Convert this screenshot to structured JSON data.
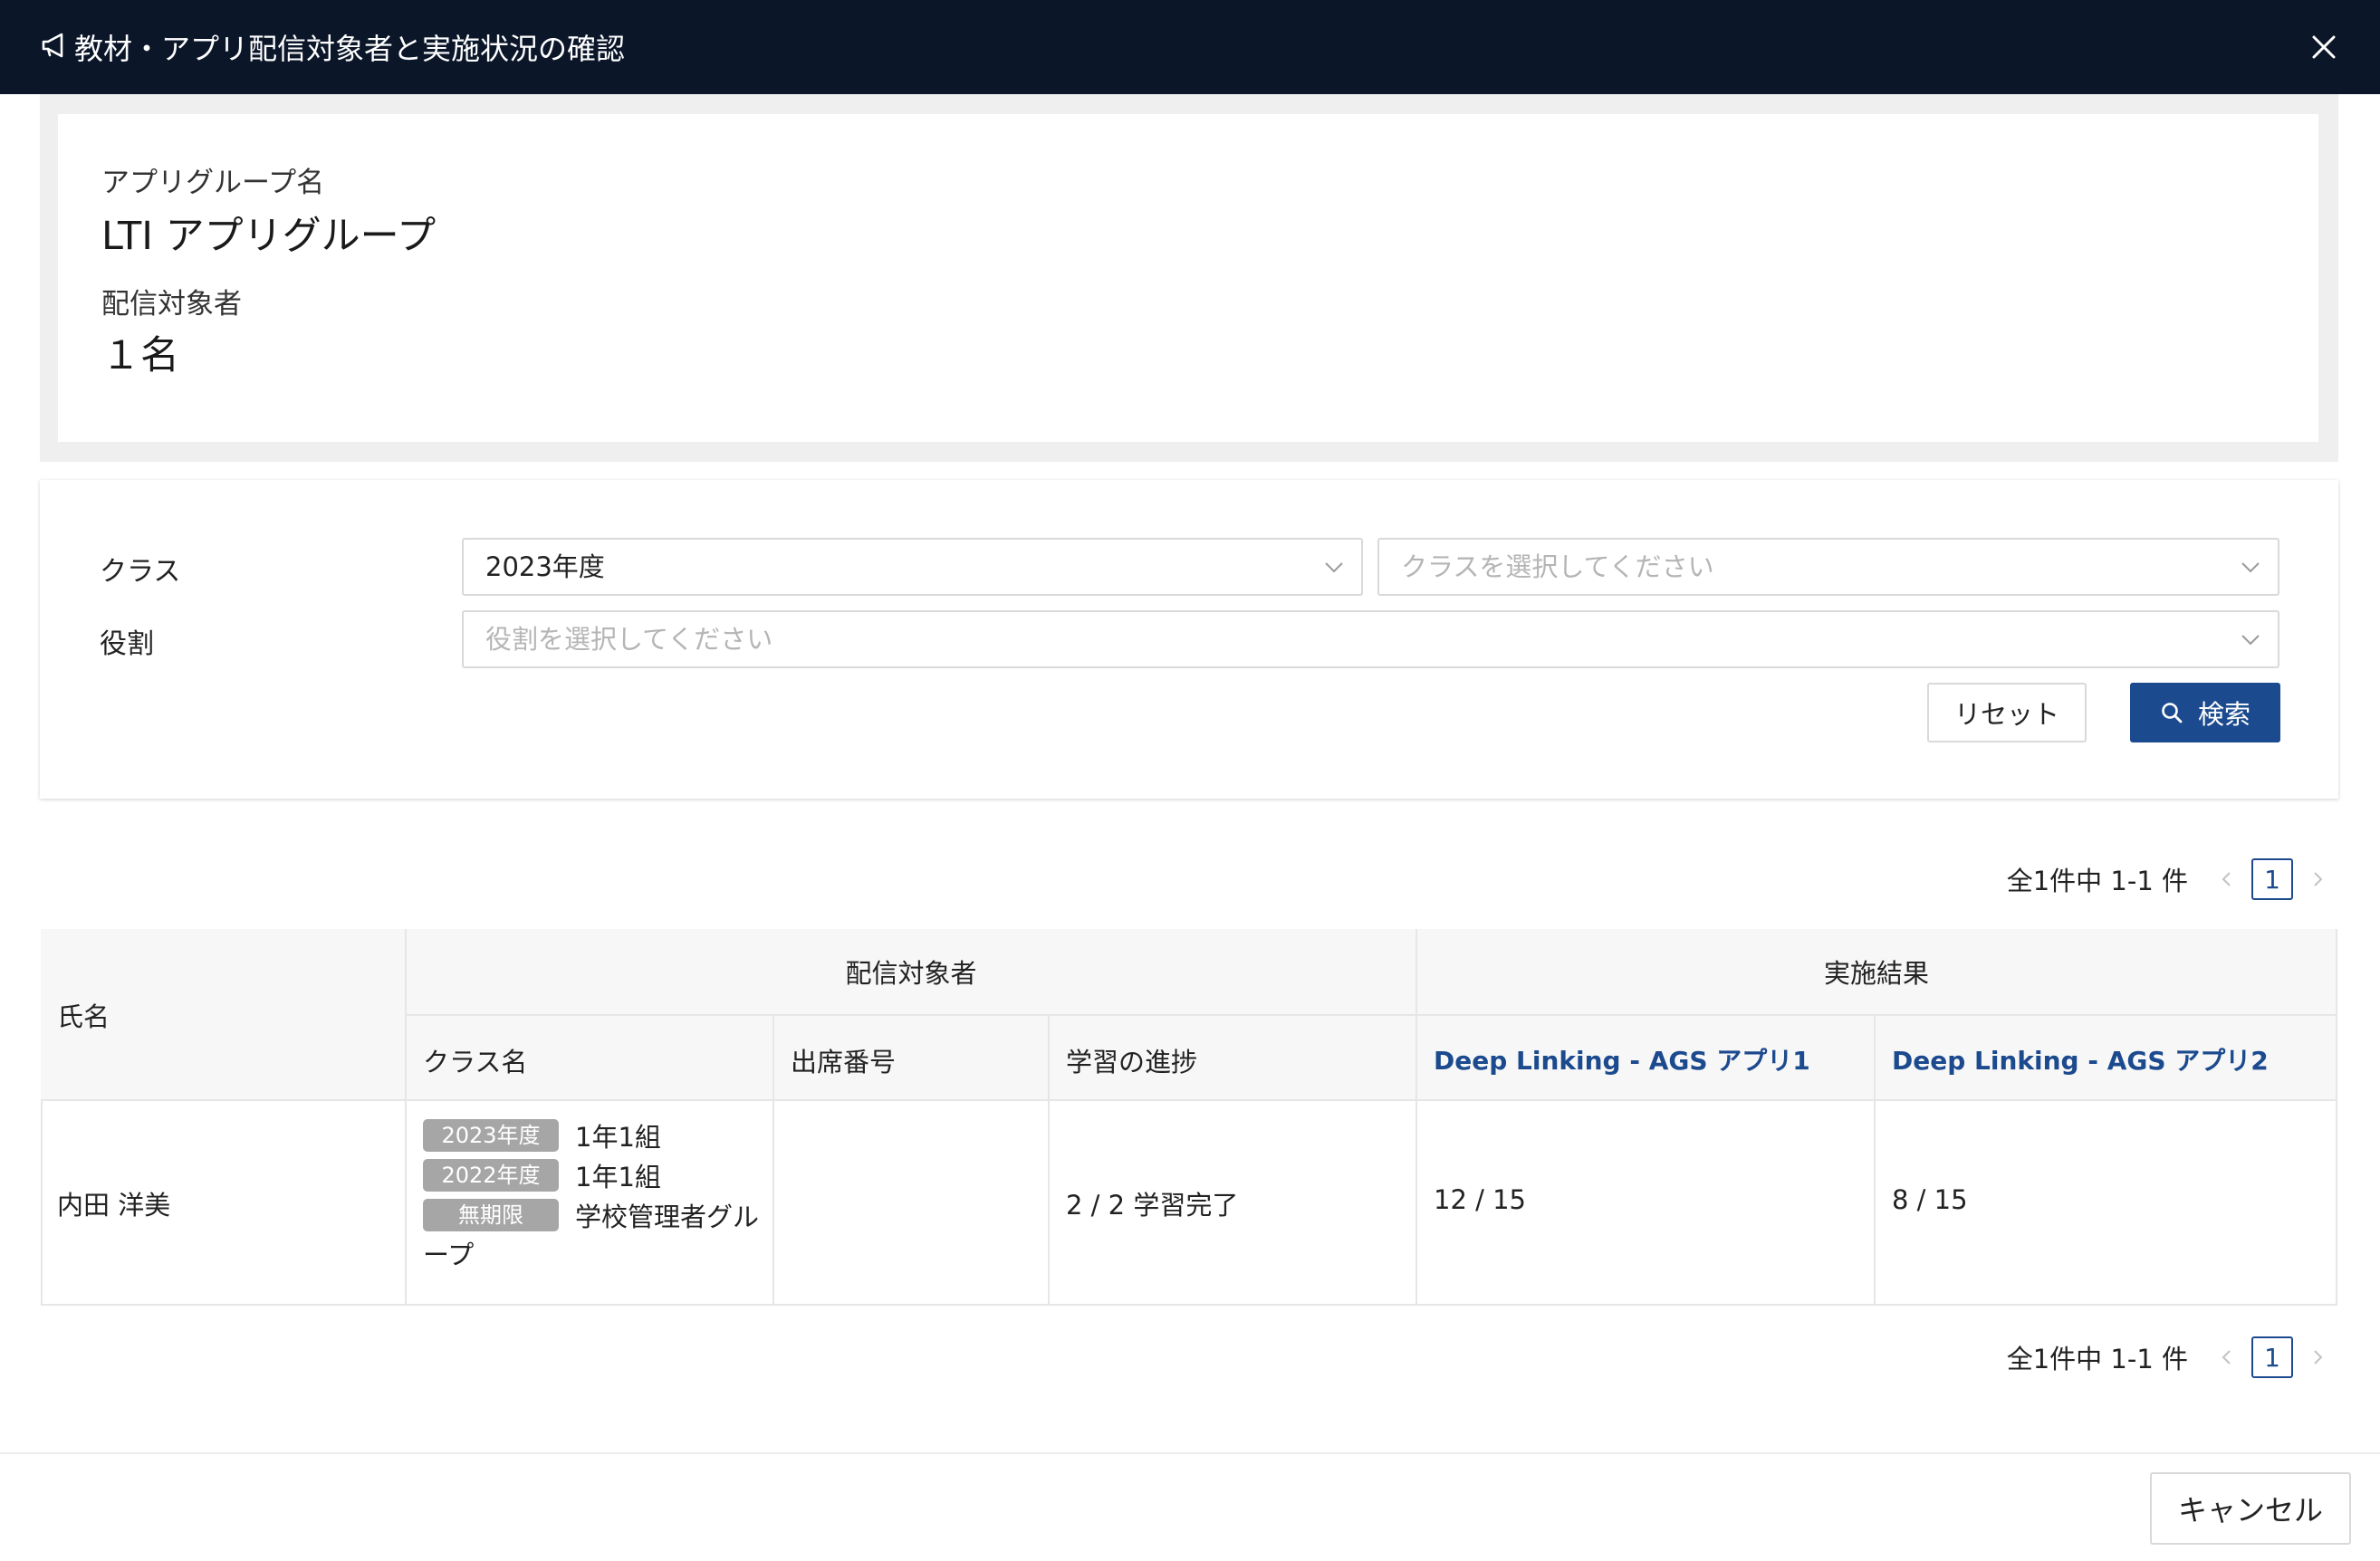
{
  "header": {
    "title": "教材・アプリ配信対象者と実施状況の確認",
    "icon": "megaphone-icon",
    "close_icon": "close-icon"
  },
  "info": {
    "app_group_label": "アプリグループ名",
    "app_group_value": "LTI アプリグループ",
    "target_label": "配信対象者",
    "target_value": "１名"
  },
  "filter": {
    "class_label": "クラス",
    "year_select_value": "2023年度",
    "class_select_placeholder": "クラスを選択してください",
    "role_label": "役割",
    "role_select_placeholder": "役割を選択してください",
    "reset_label": "リセット",
    "search_label": "検索"
  },
  "pagination": {
    "summary": "全1件中 1-1 件",
    "current_page": "1"
  },
  "table": {
    "headers": {
      "name": "氏名",
      "target_group": "配信対象者",
      "result_group": "実施結果",
      "class_name": "クラス名",
      "attendance_no": "出席番号",
      "progress": "学習の進捗",
      "app1": "Deep Linking - AGS アプリ1",
      "app2": "Deep Linking - AGS アプリ2"
    },
    "rows": [
      {
        "name": "内田 洋美",
        "classes": [
          {
            "tag": "2023年度",
            "name": "1年1組"
          },
          {
            "tag": "2022年度",
            "name": "1年1組"
          },
          {
            "tag": "無期限",
            "name": "学校管理者グル",
            "wrap": "ープ"
          }
        ],
        "attendance_no": "",
        "progress": "2 / 2 学習完了",
        "app1": "12 / 15",
        "app2": "8 / 15"
      }
    ]
  },
  "footer": {
    "cancel_label": "キャンセル"
  },
  "colors": {
    "header_bg": "#0b1629",
    "primary": "#1c4a8e",
    "tag_bg": "#a6a6a6"
  }
}
